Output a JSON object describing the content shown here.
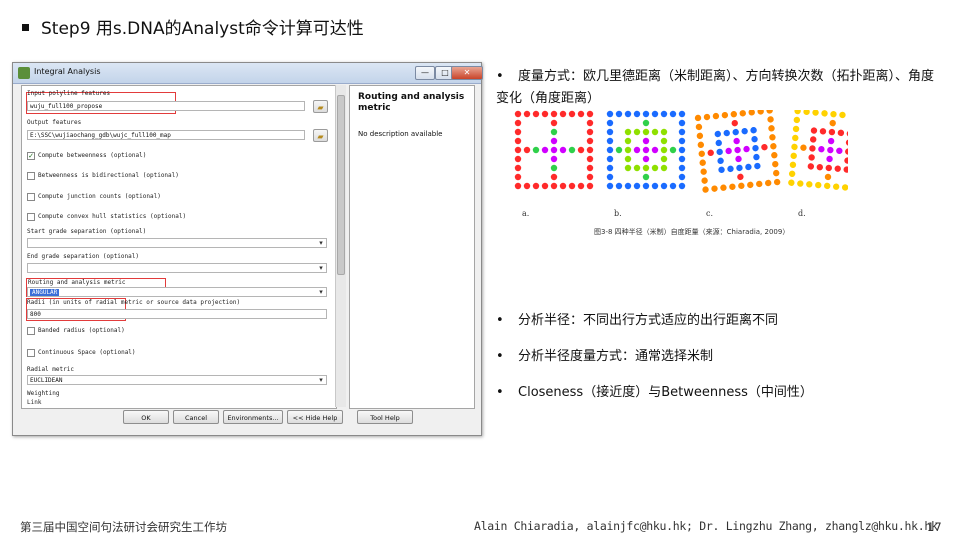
{
  "slide": {
    "title": "Step9 用s.DNA的Analyst命令计算可达性",
    "footer_left": "第三届中国空间句法研讨会研究生工作坊",
    "footer_right": "Alain Chiaradia, alainjfc@hku.hk;  Dr. Lingzhu Zhang, zhanglz@hku.hk.hk",
    "page_number": "17"
  },
  "dialog": {
    "title": "Integral Analysis",
    "controls": {
      "minimize": "—",
      "maximize": "□",
      "close": "✕"
    },
    "fields": {
      "input_label": "Input polyline features",
      "input_value": "wuju_full100_propose",
      "output_label": "Output features",
      "output_value": "E:\\SSC\\wujiaochang_gdb\\wujc_full100_map",
      "compute_betweenness": "Compute betweenness (optional)",
      "bidirectional": "Betweenness is bidirectional (optional)",
      "junction_counts": "Compute junction counts (optional)",
      "convex_hull": "Compute convex hull statistics (optional)",
      "start_grade_label": "Start grade separation (optional)",
      "end_grade_label": "End grade separation (optional)",
      "metric_label": "Routing and analysis metric",
      "metric_value": "ANGULAR",
      "radii_label": "Radii (in units of radial metric or source data projection)",
      "radii_value": "800",
      "banded_radius": "Banded radius (optional)",
      "continuous_space": "Continuous Space (optional)",
      "radial_metric_label": "Radial metric",
      "radial_metric_value": "EUCLIDEAN",
      "weighting_label": "Weighting",
      "weighting_value": "Link"
    },
    "help": {
      "title": "Routing and analysis metric",
      "description": "No description available"
    },
    "buttons": {
      "ok": "OK",
      "cancel": "Cancel",
      "environments": "Environments...",
      "hide_help": "<< Hide Help",
      "tool_help": "Tool Help"
    }
  },
  "bullets": [
    {
      "dot": "•",
      "text": "度量方式：欧几里德距离（米制距离）、方向转换次数（拓扑距离）、角度变化（角度距离）"
    },
    {
      "dot": "•",
      "text": "分析半径：不同出行方式适应的出行距离不同"
    },
    {
      "dot": "•",
      "text": "分析半径度量方式：通常选择米制"
    },
    {
      "dot": "•",
      "text": "Closeness（接近度）与Betweenness（中间性）"
    }
  ],
  "figure": {
    "panel_labels": [
      "a.",
      "b.",
      "c.",
      "d."
    ],
    "caption": "图3-8 四种半径（米制）自度距量（来源：Chiaradia, 2009）",
    "colors": [
      "#ff2a2a",
      "#ff8a00",
      "#ffd200",
      "#8fe000",
      "#2fd04a",
      "#1a6bff",
      "#d000ff"
    ]
  }
}
